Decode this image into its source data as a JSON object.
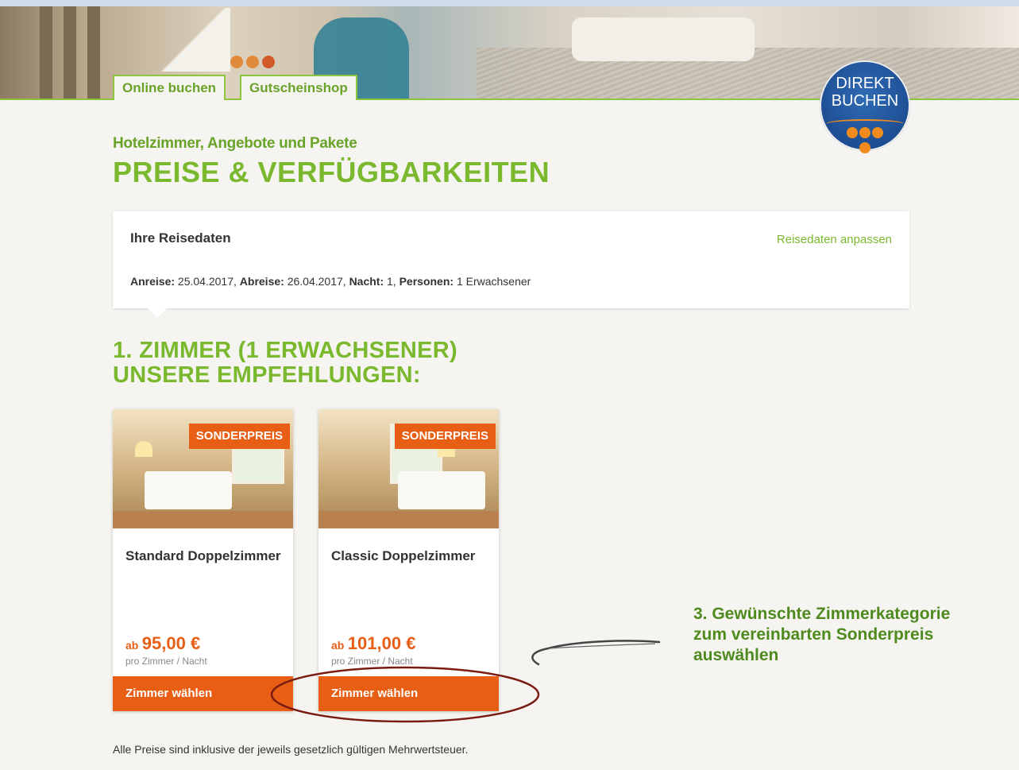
{
  "tabs": [
    {
      "label": "Online buchen"
    },
    {
      "label": "Gutscheinshop"
    }
  ],
  "badge": {
    "line1": "DIREKT",
    "line2": "BUCHEN"
  },
  "page": {
    "subtitle": "Hotelzimmer, Angebote und Pakete",
    "title": "PREISE & VERFÜGBARKEITEN"
  },
  "travel": {
    "heading": "Ihre Reisedaten",
    "adjust_link": "Reisedaten anpassen",
    "arrival_label": "Anreise:",
    "arrival": "25.04.2017,",
    "departure_label": "Abreise:",
    "departure": "26.04.2017,",
    "nights_label": "Nacht:",
    "nights": "1,",
    "persons_label": "Personen:",
    "persons": "1 Erwachsener"
  },
  "section": {
    "line1": "1. ZIMMER (1 ERWACHSENER)",
    "line2": "UNSERE EMPFEHLUNGEN:"
  },
  "rooms": [
    {
      "badge": "SONDERPREIS",
      "name": "Standard Doppelzimmer",
      "ab": "ab",
      "price": "95,00 €",
      "per": "pro Zimmer / Nacht",
      "button": "Zimmer wählen"
    },
    {
      "badge": "SONDERPREIS",
      "name": "Classic Doppelzimmer",
      "ab": "ab",
      "price": "101,00 €",
      "per": "pro Zimmer / Nacht",
      "button": "Zimmer wählen"
    }
  ],
  "annotation": {
    "text": "3. Gewünschte Zimmerkategorie zum vereinbarten Sonderpreis auswählen"
  },
  "footer": {
    "note": "Alle Preise sind inklusive der jeweils gesetzlich gültigen Mehrwertsteuer."
  },
  "colors": {
    "accent_green": "#7ab82e",
    "accent_orange": "#e95e15",
    "badge_blue": "#1d4d92"
  }
}
